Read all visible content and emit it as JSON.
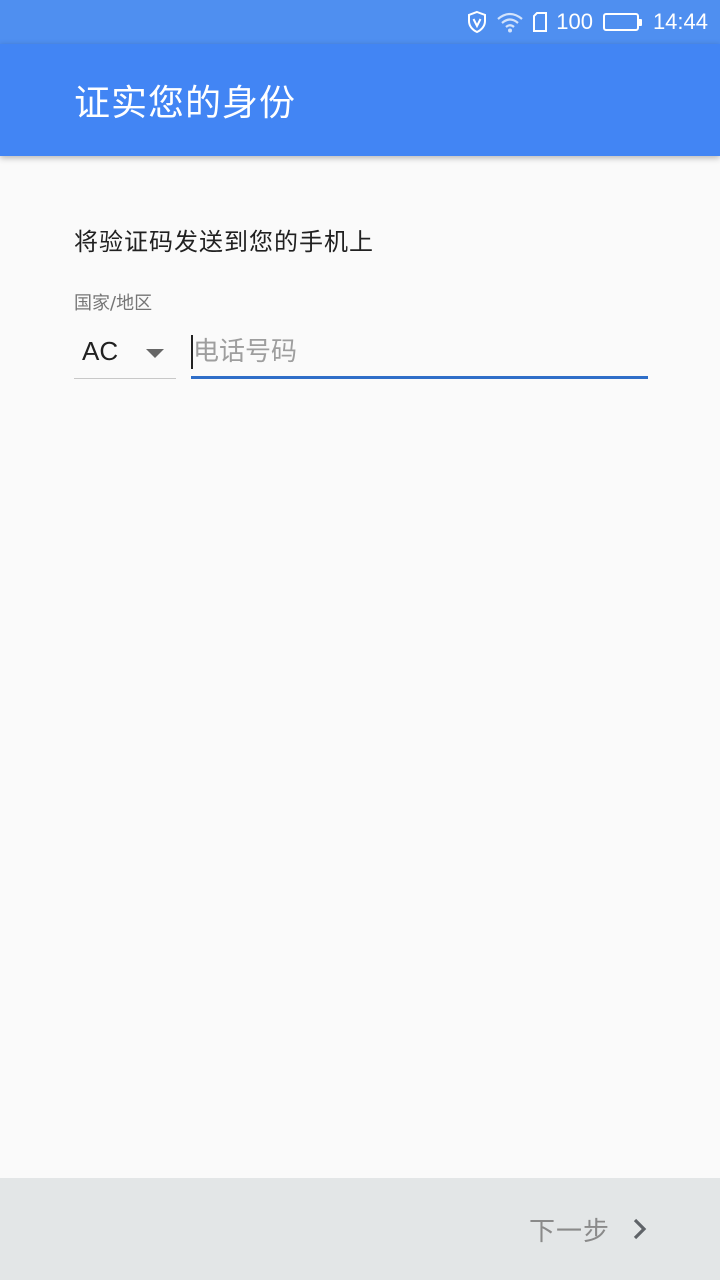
{
  "status_bar": {
    "battery_percent": "100",
    "time": "14:44",
    "icons": [
      "vpn-shield-icon",
      "wifi-icon",
      "sim-card-icon",
      "battery-icon"
    ],
    "background": "#4f8ff0"
  },
  "app_bar": {
    "title": "证实您的身份",
    "background": "#4285f4"
  },
  "form": {
    "instruction": "将验证码发送到您的手机上",
    "country_label": "国家/地区",
    "country_value": "AC",
    "phone_value": "",
    "phone_placeholder": "电话号码",
    "accent": "#2f6ec8"
  },
  "footer": {
    "next_label": "下一步",
    "next_icon": "chevron-right-icon",
    "background": "#e3e6e7"
  }
}
